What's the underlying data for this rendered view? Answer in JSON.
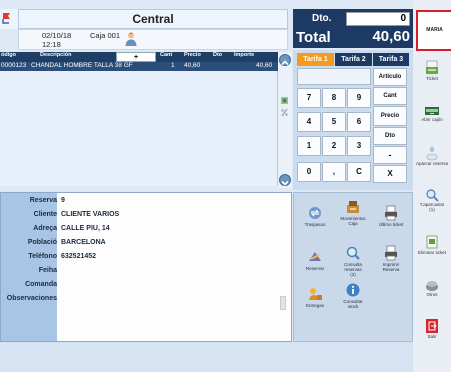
{
  "header": {
    "title": "Central",
    "date": "02/10/18",
    "caja": "Caja 001",
    "time": "12:18"
  },
  "grid": {
    "columns": {
      "codigo": "ódigo",
      "descripcion": "Descripción",
      "add": "+",
      "cant": "Cant",
      "precio": "Precio",
      "dto": "Dto",
      "importe": "Importe"
    },
    "rows": [
      {
        "codigo": "0000123",
        "descripcion": "CHANDAL HOMBRE TALLA 38 GF",
        "cant": "1",
        "precio": "40,60",
        "dto": "",
        "importe": "40,60"
      }
    ]
  },
  "detail": {
    "labels": {
      "reserva": "Reserva",
      "cliente": "Cliente",
      "adreca": "Adreça",
      "poblacio": "Població",
      "telefono": "Teléfono",
      "fecha": "Feiha",
      "comanda": "Comanda",
      "observaciones": "Observaciones"
    },
    "values": {
      "reserva": "9",
      "cliente": "CLIENTE VARIOS",
      "adreca": "CALLE PIU, 14",
      "poblacio": "BARCELONA",
      "telefono": "632521452"
    }
  },
  "totals": {
    "dto_label": "Dto.",
    "dto_value": "0",
    "total_label": "Total",
    "total_value": "40,60"
  },
  "keypad": {
    "tabs": [
      "Tarifa 1",
      "Tarifa 2",
      "Tarifa 3"
    ],
    "keys": [
      "7",
      "8",
      "9",
      "4",
      "5",
      "6",
      "1",
      "2",
      "3",
      "0",
      ",",
      "C"
    ],
    "functions": [
      "Artículo",
      "Cant",
      "Precio",
      "Dto",
      "-",
      "X"
    ],
    "colors": {
      "active_tab": "#f39a1f",
      "tab": "#1c3a63"
    }
  },
  "actions": [
    {
      "label": "Traspasos",
      "icon": "transfer-icon"
    },
    {
      "label": "Movimientos\nCaja",
      "icon": "cash-register-icon"
    },
    {
      "label": "Último ticket",
      "icon": "printer-icon"
    },
    {
      "label": "Reservar",
      "icon": "reserve-icon"
    },
    {
      "label": "Consulta\nreservas\n(2)",
      "icon": "search-reserves-icon"
    },
    {
      "label": "Imprimir\nReserva",
      "icon": "print-reserve-icon"
    },
    {
      "label": "Entregas",
      "icon": "delivery-icon"
    },
    {
      "label": "Consultar\nstock",
      "icon": "info-icon"
    }
  ],
  "toolbar": {
    "user": "MARIA",
    "buttons": [
      {
        "label": "Ticket",
        "icon": "ticket-icon"
      },
      {
        "label": "Abrir cajón",
        "icon": "drawer-icon"
      },
      {
        "label": "Aparcar reserva",
        "icon": "park-icon"
      },
      {
        "label": "T.aparcados\n(1)",
        "icon": "parked-list-icon"
      },
      {
        "label": "Eliminar ticket",
        "icon": "delete-ticket-icon"
      },
      {
        "label": "Otros",
        "icon": "others-icon"
      },
      {
        "label": "Salir",
        "icon": "exit-icon"
      }
    ]
  }
}
